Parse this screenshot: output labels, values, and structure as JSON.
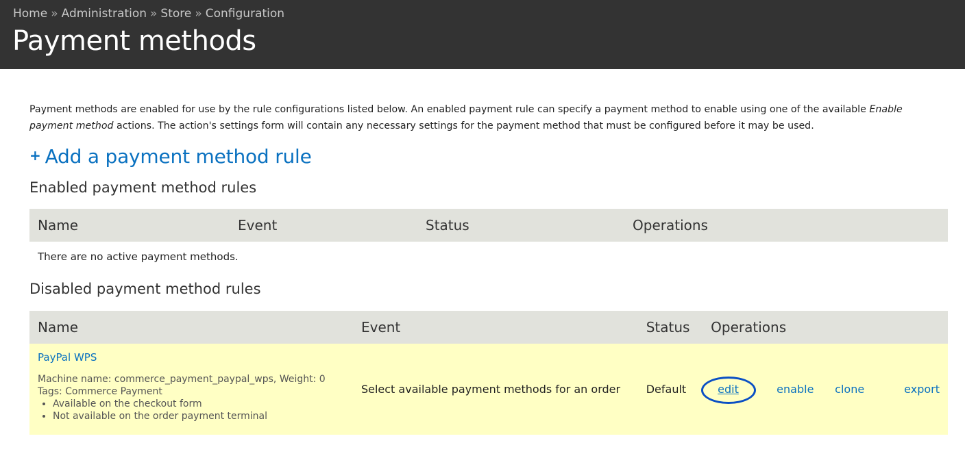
{
  "breadcrumb": {
    "items": [
      "Home",
      "Administration",
      "Store",
      "Configuration"
    ],
    "separator": "»"
  },
  "page_title": "Payment methods",
  "intro": {
    "part1": "Payment methods are enabled for use by the rule configurations listed below. An enabled payment rule can specify a payment method to enable using one of the available ",
    "emphasis": "Enable payment method",
    "part2": " actions. The action's settings form will contain any necessary settings for the payment method that must be configured before it may be used."
  },
  "add_rule": {
    "icon": "plus-icon",
    "label": "Add a payment method rule"
  },
  "enabled": {
    "title": "Enabled payment method rules",
    "columns": [
      "Name",
      "Event",
      "Status",
      "Operations"
    ],
    "empty_text": "There are no active payment methods."
  },
  "disabled": {
    "title": "Disabled payment method rules",
    "columns": [
      "Name",
      "Event",
      "Status",
      "Operations"
    ],
    "rows": [
      {
        "name": "PayPal WPS",
        "machine": "Machine name: commerce_payment_paypal_wps, Weight: 0",
        "tags": "Tags: Commerce Payment",
        "notes": [
          "Available on the checkout form",
          "Not available on the order payment terminal"
        ],
        "event": "Select available payment methods for an order",
        "status": "Default",
        "operations": [
          "edit",
          "enable",
          "clone",
          "export"
        ]
      }
    ]
  },
  "colors": {
    "header_bg": "#333333",
    "link": "#0a71c0",
    "table_header_bg": "#e1e2dc",
    "row_highlight": "#ffffc4",
    "annotation_ring": "#0a4fc4"
  }
}
